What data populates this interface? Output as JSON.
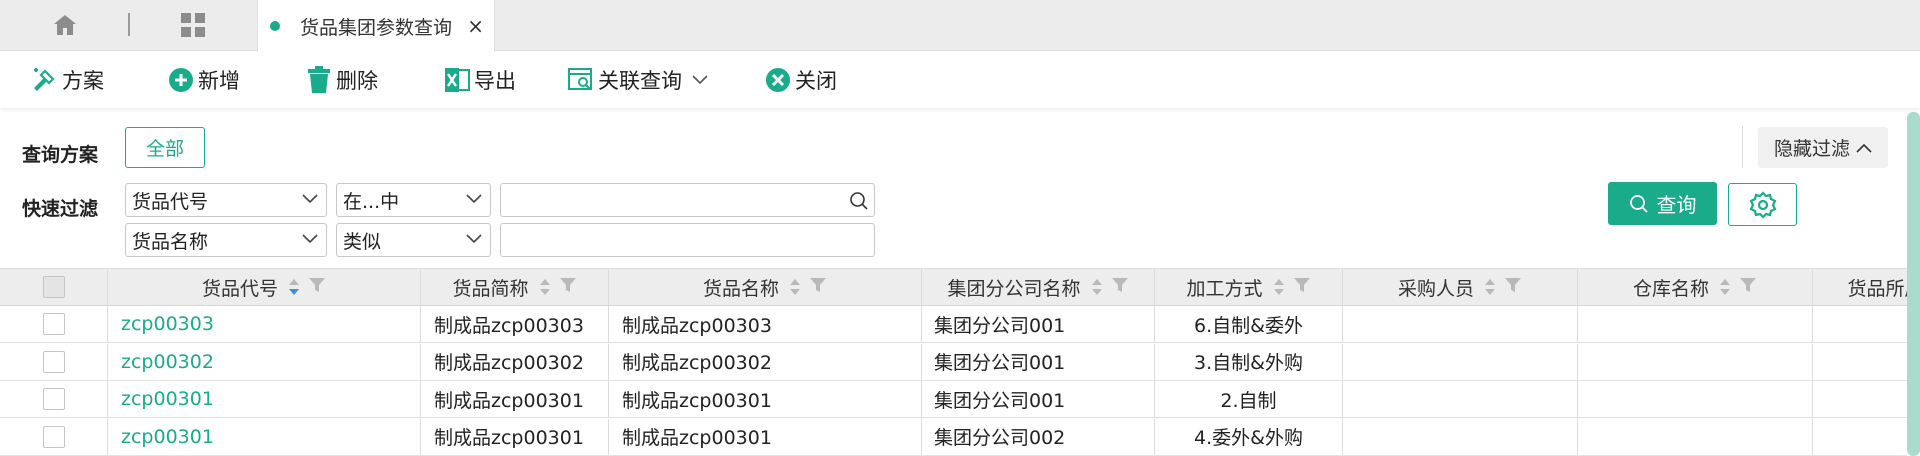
{
  "tabbar": {
    "home_icon": "home-icon",
    "apps_icon": "grid-icon",
    "active_tab": {
      "label": "货品集团参数查询",
      "close": "×"
    }
  },
  "toolbar": {
    "scheme": "方案",
    "add": "新增",
    "delete": "删除",
    "export": "导出",
    "related_query": "关联查询",
    "close": "关闭"
  },
  "filter": {
    "scheme_label": "查询方案",
    "all_button": "全部",
    "quick_label": "快速过滤",
    "row1": {
      "field": "货品代号",
      "operator": "在...中",
      "value": ""
    },
    "row2": {
      "field": "货品名称",
      "operator": "类似",
      "value": ""
    },
    "hide_filter": "隐藏过滤",
    "query_button": "查询"
  },
  "colors": {
    "accent": "#1aab8a",
    "header_bg": "#ededed",
    "sort_active": "#3a8ee6"
  },
  "table": {
    "headers": [
      "货品代号",
      "货品简称",
      "货品名称",
      "集团分公司名称",
      "加工方式",
      "采购人员",
      "仓库名称",
      "货品所属"
    ],
    "rows": [
      {
        "code": "zcp00303",
        "short_name": "制成品zcp00303",
        "name": "制成品zcp00303",
        "company": "集团分公司001",
        "process": "6.自制&委外",
        "buyer": "",
        "warehouse": ""
      },
      {
        "code": "zcp00302",
        "short_name": "制成品zcp00302",
        "name": "制成品zcp00302",
        "company": "集团分公司001",
        "process": "3.自制&外购",
        "buyer": "",
        "warehouse": ""
      },
      {
        "code": "zcp00301",
        "short_name": "制成品zcp00301",
        "name": "制成品zcp00301",
        "company": "集团分公司001",
        "process": "2.自制",
        "buyer": "",
        "warehouse": ""
      },
      {
        "code": "zcp00301",
        "short_name": "制成品zcp00301",
        "name": "制成品zcp00301",
        "company": "集团分公司002",
        "process": "4.委外&外购",
        "buyer": "",
        "warehouse": ""
      }
    ]
  }
}
